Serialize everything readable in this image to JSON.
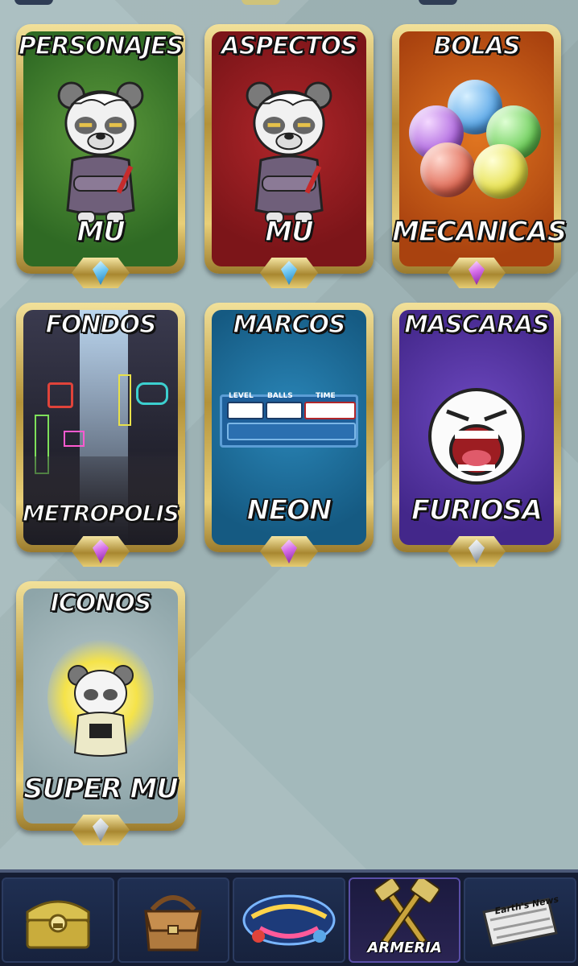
{
  "cards": [
    {
      "title": "PERSONAJES",
      "subtitle": "MU",
      "color": "#3f7d2b",
      "gem": "blue",
      "art": "panda-character"
    },
    {
      "title": "ASPECTOS",
      "subtitle": "MU",
      "color": "#8e1f24",
      "gem": "blue",
      "art": "panda-character"
    },
    {
      "title": "BOLAS",
      "subtitle": "MECANICAS",
      "color": "#c2561a",
      "gem": "purple",
      "art": "mechanical-balls"
    },
    {
      "title": "FONDOS",
      "subtitle": "METROPOLIS",
      "color": "#2c2d3d",
      "gem": "purple",
      "art": "neon-city"
    },
    {
      "title": "MARCOS",
      "subtitle": "NEON",
      "color": "#1a6d9a",
      "gem": "purple",
      "art": "neon-frame"
    },
    {
      "title": "MASCARAS",
      "subtitle": "FURIOSA",
      "color": "#5b3aa5",
      "gem": "silver",
      "art": "angry-mask"
    },
    {
      "title": "ICONOS",
      "subtitle": "SUPER MU",
      "color": "#9cb1b4",
      "gem": "silver",
      "art": "super-panda"
    }
  ],
  "frame": {
    "level": "LEVEL",
    "balls": "BALLS",
    "time": "TIME"
  },
  "nav": {
    "tabs": [
      {
        "icon": "treasure-chest-icon",
        "label": ""
      },
      {
        "icon": "bag-icon",
        "label": ""
      },
      {
        "icon": "game-logo-icon",
        "label": ""
      },
      {
        "icon": "hammers-icon",
        "label": "ARMERIA",
        "active": true
      },
      {
        "icon": "newspaper-icon",
        "label": ""
      }
    ],
    "news_label": "Earth's News"
  }
}
